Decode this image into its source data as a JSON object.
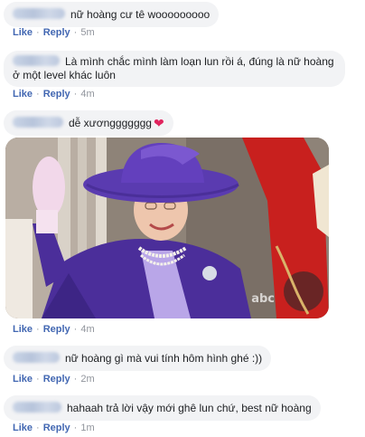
{
  "comments": [
    {
      "text": "nữ hoàng cư tê wooooooooo",
      "like": "Like",
      "reply": "Reply",
      "time": "5m"
    },
    {
      "line1": "Là mình chắc mình làm loạn lun rồi á, đúng là nữ hoàng",
      "line2": "ở một level khác luôn",
      "like": "Like",
      "reply": "Reply",
      "time": "4m"
    },
    {
      "text": "dễ xươnggggggg",
      "heart": "❤",
      "like": "Like",
      "reply": "Reply",
      "time": "4m"
    },
    {
      "text": "nữ hoàng gì mà vui tính hôm hình ghé :))",
      "like": "Like",
      "reply": "Reply",
      "time": "2m"
    },
    {
      "text": "hahaah trả lời vậy mới ghê lun chứ, best nữ hoàng",
      "like": "Like",
      "reply": "Reply",
      "time": "1m"
    }
  ],
  "gif": {
    "watermark": "abc",
    "colors": {
      "coat": "#4b2e9a",
      "hat": "#5a3bb0",
      "guard": "#c8201e",
      "background": "#9c8f84"
    }
  },
  "colors": {
    "bubble": "#f2f3f5",
    "link": "#4267b2",
    "meta": "#90949c",
    "heart": "#e0245e"
  }
}
